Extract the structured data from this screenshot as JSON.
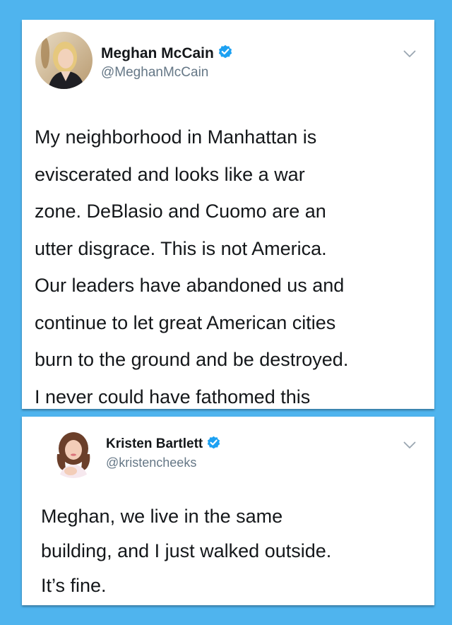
{
  "tweets": [
    {
      "name": "Meghan McCain",
      "handle": "@MeghanMcCain",
      "verified": true,
      "lines": [
        "My neighborhood in Manhattan is",
        "eviscerated and looks like a war",
        "zone. DeBlasio and Cuomo are an",
        "utter disgrace. This is not America.",
        "Our leaders have abandoned us and",
        "continue to let great American cities",
        "burn to the ground and be destroyed.",
        "I never could have fathomed this"
      ]
    },
    {
      "name": "Kristen Bartlett",
      "handle": "@kristencheeks",
      "verified": true,
      "lines": [
        "Meghan, we live in the same",
        "building, and I just walked outside.",
        "It’s fine."
      ]
    }
  ],
  "colors": {
    "background": "#4fb4ee",
    "verified_badge": "#1da1f2",
    "text": "#14171a",
    "handle": "#657786"
  },
  "icons": {
    "verified": "verified-badge-icon",
    "menu": "chevron-down-icon"
  }
}
